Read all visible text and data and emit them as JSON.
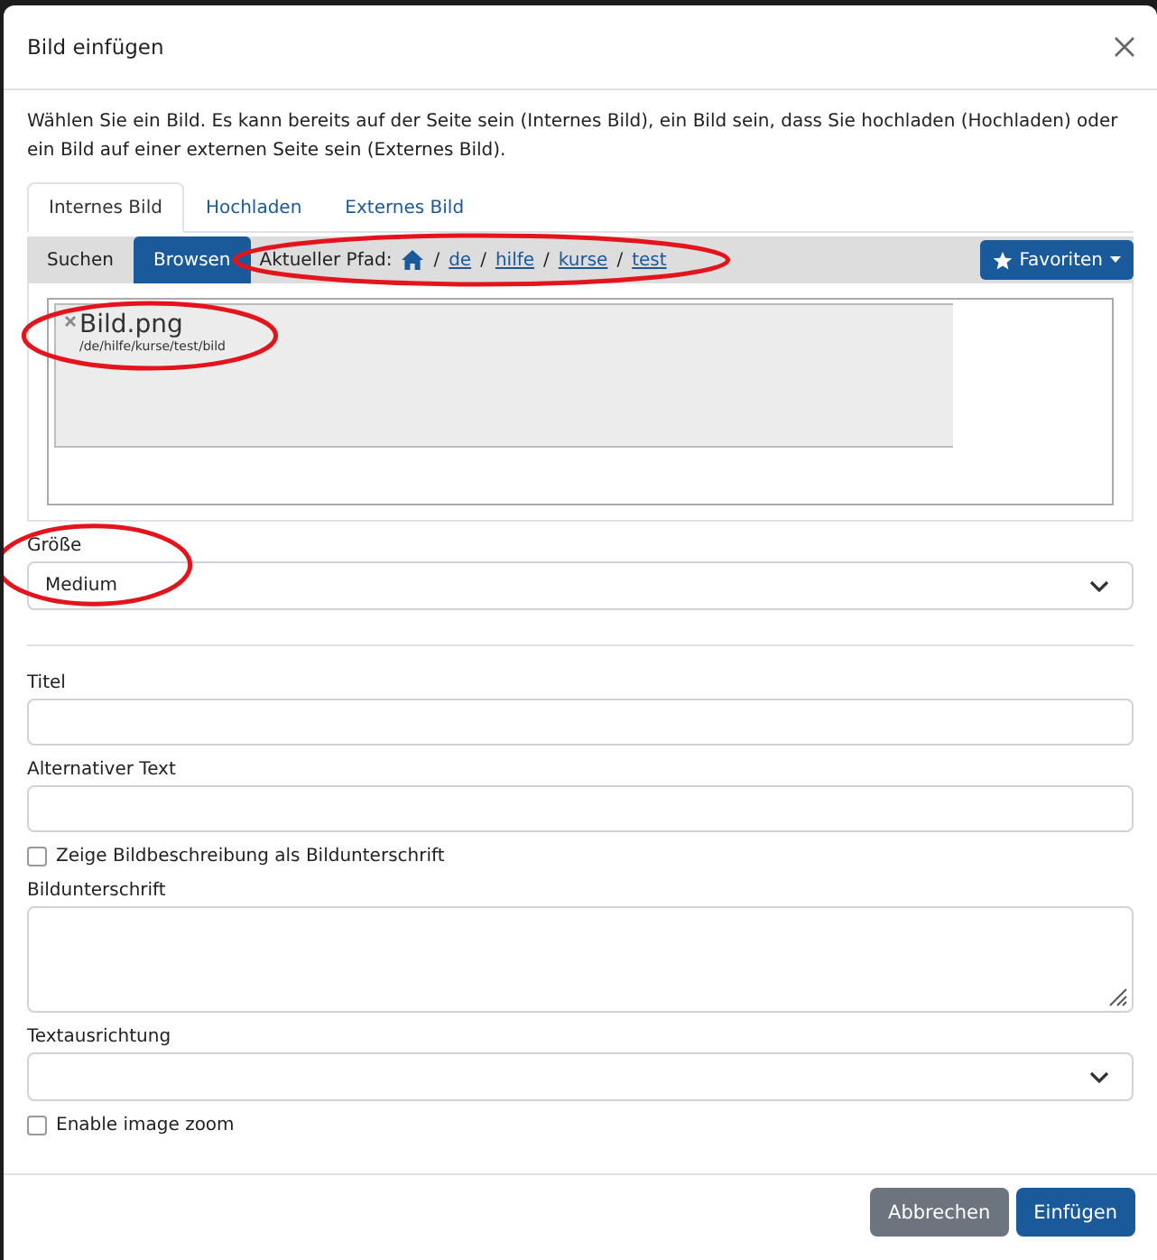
{
  "dialog": {
    "title": "Bild einfügen",
    "description": "Wählen Sie ein Bild. Es kann bereits auf der Seite sein (Internes Bild), ein Bild sein, dass Sie hochladen (Hochladen) oder ein Bild auf einer externen Seite sein (Externes Bild).",
    "tabs": [
      {
        "label": "Internes Bild",
        "selected": true
      },
      {
        "label": "Hochladen",
        "selected": false
      },
      {
        "label": "Externes Bild",
        "selected": false
      }
    ],
    "browser": {
      "modes": [
        {
          "label": "Suchen",
          "selected": false
        },
        {
          "label": "Browsen",
          "selected": true
        }
      ],
      "path": {
        "label": "Aktueller Pfad:",
        "highlighted": true,
        "crumbs": [
          {
            "kind": "home"
          },
          {
            "kind": "link",
            "separator": "/",
            "label": "de"
          },
          {
            "kind": "link",
            "separator": "/",
            "label": "hilfe"
          },
          {
            "kind": "link",
            "separator": "/",
            "label": "kurse"
          },
          {
            "kind": "link",
            "separator": "/",
            "label": "test"
          }
        ]
      },
      "favorites": {
        "label": "Favoriten"
      },
      "files": [
        {
          "name": "Bild.png",
          "path": "/de/hilfe/kurse/test/bild",
          "highlighted": true
        }
      ]
    },
    "size": {
      "label": "Größe",
      "value": "Medium",
      "highlighted": true
    },
    "fields": [
      {
        "kind": "text",
        "label": "Titel"
      },
      {
        "kind": "text",
        "label": "Alternativer Text"
      },
      {
        "kind": "checkbox",
        "label": "Zeige Bildbeschreibung als Bildunterschrift",
        "checked": false
      },
      {
        "kind": "textarea",
        "label": "Bildunterschrift"
      },
      {
        "kind": "select",
        "label": "Textausrichtung"
      },
      {
        "kind": "checkbox",
        "label": "Enable image zoom",
        "checked": false
      }
    ],
    "buttons": [
      {
        "kind": "secondary",
        "label": "Abbrechen"
      },
      {
        "kind": "primary",
        "label": "Einfügen"
      }
    ]
  }
}
